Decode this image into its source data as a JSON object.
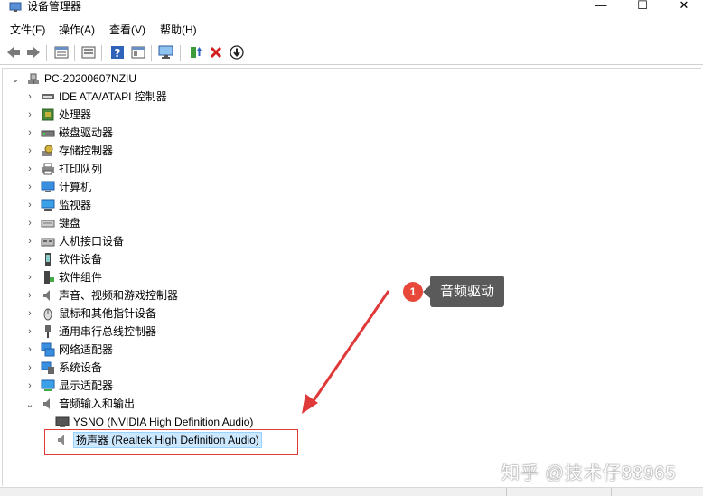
{
  "window": {
    "title": "设备管理器",
    "min_glyph": "—",
    "max_glyph": "☐",
    "close_glyph": "✕"
  },
  "menu": {
    "items": [
      "文件(F)",
      "操作(A)",
      "查看(V)",
      "帮助(H)"
    ]
  },
  "toolbar": {
    "icons": [
      "back-icon",
      "forward-icon",
      "properties-icon",
      "show-hidden-icon",
      "help-icon",
      "action-icon",
      "computer-icon",
      "update-driver-icon",
      "uninstall-icon",
      "disable-icon"
    ]
  },
  "tree": {
    "root": {
      "label": "PC-20200607NZIU",
      "expanded": true
    },
    "categories": [
      {
        "label": "IDE ATA/ATAPI 控制器",
        "icon": "ide-controller-icon",
        "expanded": false
      },
      {
        "label": "处理器",
        "icon": "processor-icon",
        "expanded": false
      },
      {
        "label": "磁盘驱动器",
        "icon": "disk-drive-icon",
        "expanded": false
      },
      {
        "label": "存储控制器",
        "icon": "storage-controller-icon",
        "expanded": false
      },
      {
        "label": "打印队列",
        "icon": "printer-icon",
        "expanded": false
      },
      {
        "label": "计算机",
        "icon": "computer-icon",
        "expanded": false
      },
      {
        "label": "监视器",
        "icon": "monitor-icon",
        "expanded": false
      },
      {
        "label": "键盘",
        "icon": "keyboard-icon",
        "expanded": false
      },
      {
        "label": "人机接口设备",
        "icon": "hid-icon",
        "expanded": false
      },
      {
        "label": "软件设备",
        "icon": "software-device-icon",
        "expanded": false
      },
      {
        "label": "软件组件",
        "icon": "software-component-icon",
        "expanded": false
      },
      {
        "label": "声音、视频和游戏控制器",
        "icon": "sound-icon",
        "expanded": false
      },
      {
        "label": "鼠标和其他指针设备",
        "icon": "mouse-icon",
        "expanded": false
      },
      {
        "label": "通用串行总线控制器",
        "icon": "usb-icon",
        "expanded": false
      },
      {
        "label": "网络适配器",
        "icon": "network-adapter-icon",
        "expanded": false
      },
      {
        "label": "系统设备",
        "icon": "system-device-icon",
        "expanded": false
      },
      {
        "label": "显示适配器",
        "icon": "display-adapter-icon",
        "expanded": false
      },
      {
        "label": "音频输入和输出",
        "icon": "audio-io-icon",
        "expanded": true
      }
    ],
    "audio_children": [
      {
        "label": "YSNO (NVIDIA High Definition Audio)",
        "icon": "monitor-audio-icon"
      },
      {
        "label": "扬声器 (Realtek High Definition Audio)",
        "icon": "speaker-icon",
        "selected": true
      }
    ]
  },
  "annotation": {
    "badge": "1",
    "callout": "音频驱动",
    "arrow_color": "#e0393a"
  },
  "watermark": "知乎 @技术仔88965"
}
